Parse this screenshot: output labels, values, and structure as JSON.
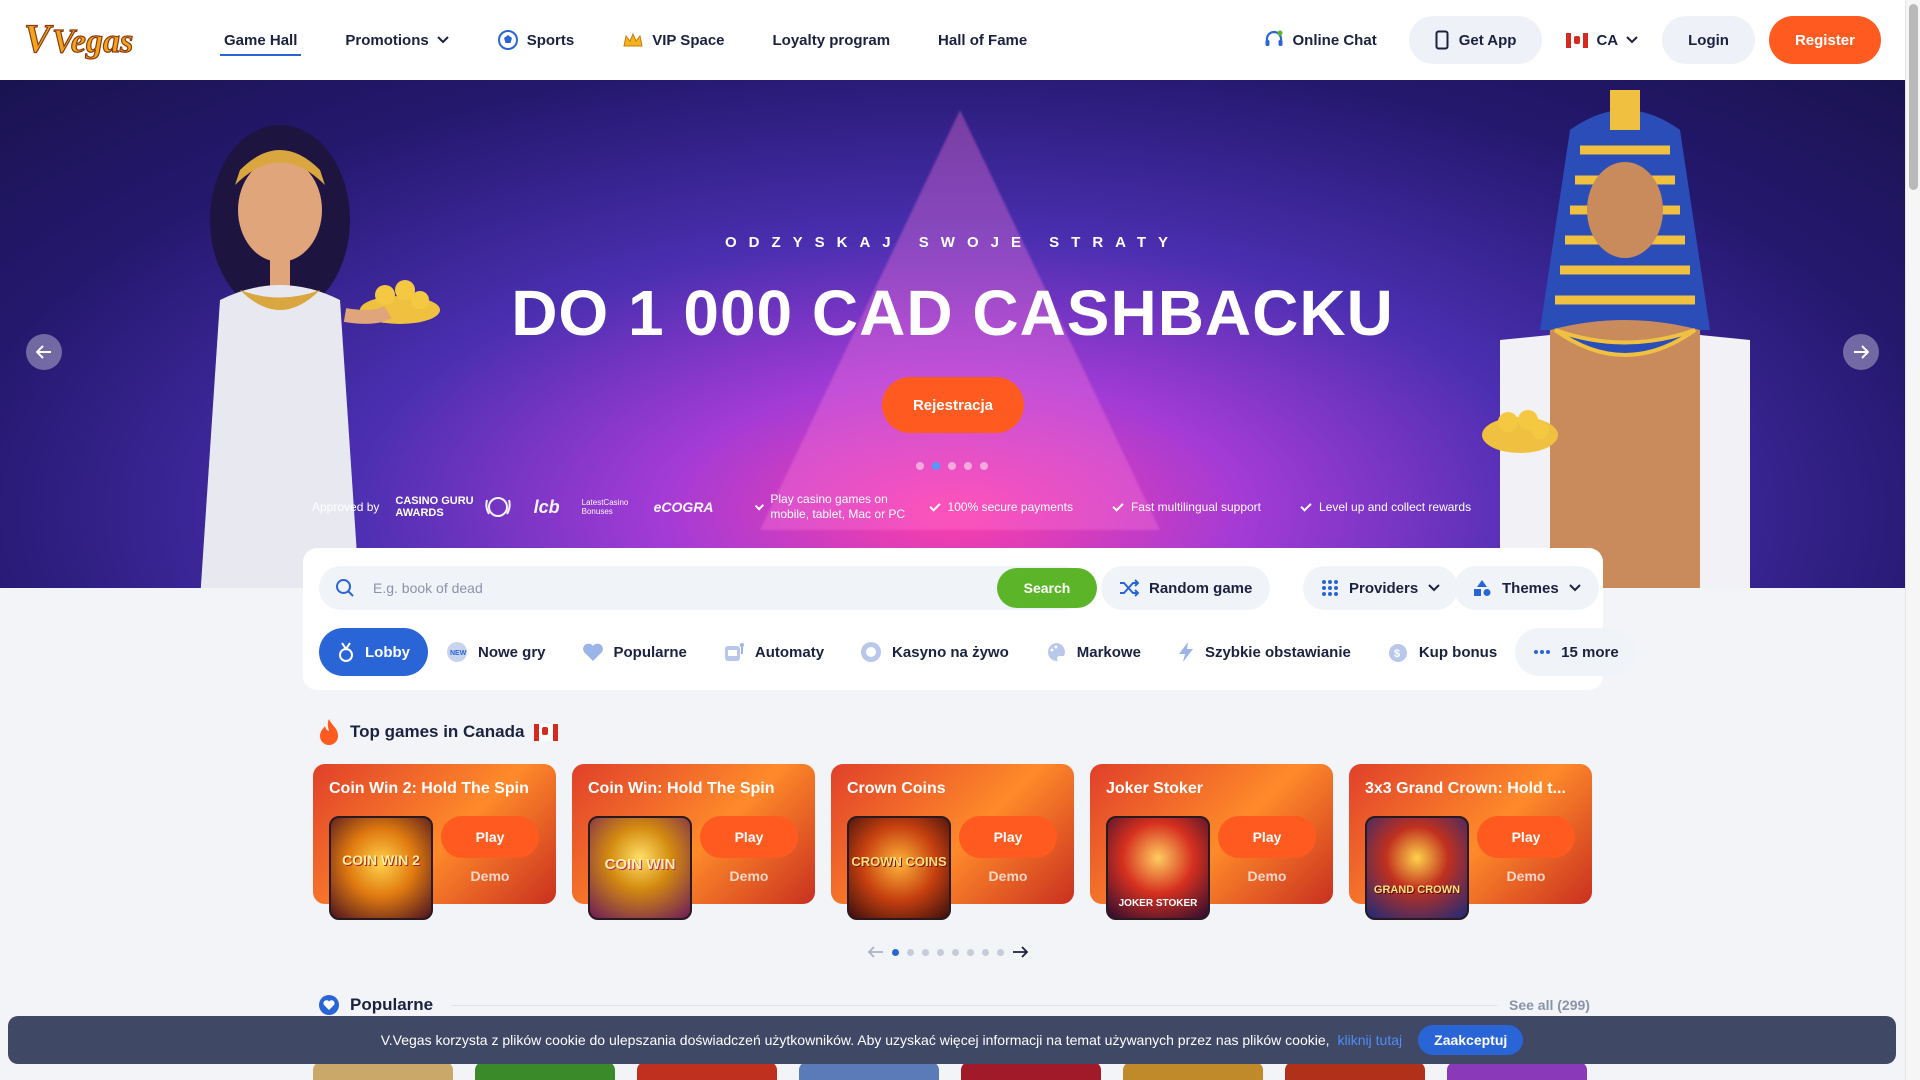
{
  "brand": {
    "logo_text": "Vegas"
  },
  "nav": {
    "items": [
      {
        "label": "Game Hall",
        "icon": "none",
        "active": true
      },
      {
        "label": "Promotions",
        "icon": "chevron-down-icon",
        "active": false
      },
      {
        "label": "Sports",
        "icon": "soccer-ball-icon",
        "active": false
      },
      {
        "label": "VIP Space",
        "icon": "crown-icon",
        "active": false
      },
      {
        "label": "Loyalty program",
        "icon": "none",
        "active": false
      },
      {
        "label": "Hall of Fame",
        "icon": "none",
        "active": false
      }
    ]
  },
  "header": {
    "chat_label": "Online Chat",
    "get_app_label": "Get App",
    "country_code": "CA",
    "login_label": "Login",
    "register_label": "Register"
  },
  "hero": {
    "subtitle": "ODZYSKAJ SWOJE STRATY",
    "title": "DO 1 000 CAD CASHBACKU",
    "cta_label": "Rejestracja",
    "slides_count": 5,
    "active_slide": 2,
    "approved_label": "Approved by",
    "award_line1": "CASINO GURU",
    "award_line2": "AWARDS",
    "partner_marks": [
      "lcb",
      "LatestCasino Bonuses",
      "eCOGRA"
    ],
    "features": [
      "Play casino games on mobile, tablet, Mac or PC",
      "100% secure payments",
      "Fast multilingual support",
      "Level up and collect rewards"
    ]
  },
  "search": {
    "placeholder": "E.g. book of dead",
    "value": "",
    "button_label": "Search",
    "random_label": "Random game",
    "providers_label": "Providers",
    "themes_label": "Themes"
  },
  "categories": [
    {
      "label": "Lobby",
      "icon": "medal-icon",
      "active": true
    },
    {
      "label": "Nowe gry",
      "icon": "new-badge-icon",
      "active": false
    },
    {
      "label": "Popularne",
      "icon": "heart-icon",
      "active": false
    },
    {
      "label": "Automaty",
      "icon": "slot-machine-icon",
      "active": false
    },
    {
      "label": "Kasyno na żywo",
      "icon": "live-chip-icon",
      "active": false
    },
    {
      "label": "Markowe",
      "icon": "palette-icon",
      "active": false
    },
    {
      "label": "Szybkie obstawianie",
      "icon": "lightning-icon",
      "active": false
    },
    {
      "label": "Kup bonus",
      "icon": "coin-bag-icon",
      "active": false
    },
    {
      "label": "15 more",
      "icon": "more-dots-icon",
      "active": false
    }
  ],
  "top_games": {
    "title": "Top games in Canada",
    "play_label": "Play",
    "demo_label": "Demo",
    "games": [
      {
        "title": "Coin Win 2: Hold The Spin",
        "thumb_text": "COIN WIN 2"
      },
      {
        "title": "Coin Win: Hold The Spin",
        "thumb_text": "COIN WIN"
      },
      {
        "title": "Crown Coins",
        "thumb_text": "CROWN COINS"
      },
      {
        "title": "Joker Stoker",
        "thumb_text": "JOKER STOKER"
      },
      {
        "title": "3x3 Grand Crown: Hold t...",
        "thumb_text": "GRAND CROWN"
      }
    ],
    "pages": 8,
    "active_page": 1
  },
  "popular": {
    "title": "Popularne",
    "see_all_label": "See all (299)"
  },
  "cookie": {
    "text": "V.Vegas korzysta z plików cookie do ulepszania doświadczeń użytkowników. Aby uzyskać więcej informacji na temat używanych przez nas plików cookie, kliknij tutaj",
    "link_label": "kliknij tutaj",
    "accept_label": "Zaakceptuj"
  },
  "colors": {
    "accent": "#ff5a1f",
    "primary": "#2a65d8",
    "search_green": "#5cb528",
    "text": "#1b2240"
  }
}
